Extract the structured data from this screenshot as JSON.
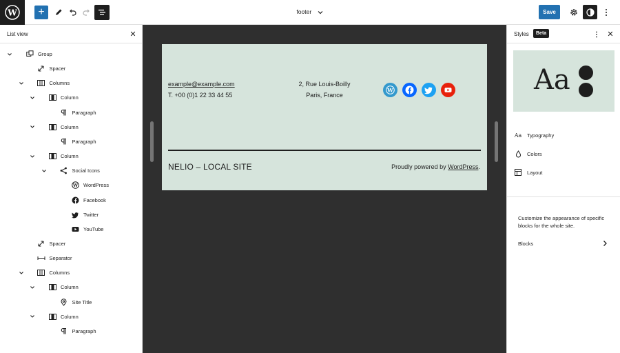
{
  "topbar": {
    "add_label": "+",
    "document_title": "footer",
    "save_label": "Save"
  },
  "list_view": {
    "title": "List view",
    "items": [
      {
        "label": "Group",
        "icon": "group-icon",
        "chevron": true
      },
      {
        "label": "Spacer",
        "icon": "spacer-icon",
        "chevron": false
      },
      {
        "label": "Columns",
        "icon": "columns-icon",
        "chevron": true
      },
      {
        "label": "Column",
        "icon": "column-icon",
        "chevron": true
      },
      {
        "label": "Paragraph",
        "icon": "paragraph-icon",
        "chevron": false
      },
      {
        "label": "Column",
        "icon": "column-icon",
        "chevron": true
      },
      {
        "label": "Paragraph",
        "icon": "paragraph-icon",
        "chevron": false
      },
      {
        "label": "Column",
        "icon": "column-icon",
        "chevron": true
      },
      {
        "label": "Social Icons",
        "icon": "share-icon",
        "chevron": true
      },
      {
        "label": "WordPress",
        "icon": "wordpress-icon",
        "chevron": false
      },
      {
        "label": "Facebook",
        "icon": "facebook-icon",
        "chevron": false
      },
      {
        "label": "Twitter",
        "icon": "twitter-icon",
        "chevron": false
      },
      {
        "label": "YouTube",
        "icon": "youtube-icon",
        "chevron": false
      },
      {
        "label": "Spacer",
        "icon": "spacer-icon",
        "chevron": false
      },
      {
        "label": "Separator",
        "icon": "separator-icon",
        "chevron": false
      },
      {
        "label": "Columns",
        "icon": "columns-icon",
        "chevron": true
      },
      {
        "label": "Column",
        "icon": "column-icon",
        "chevron": true
      },
      {
        "label": "Site Title",
        "icon": "map-marker-icon",
        "chevron": false
      },
      {
        "label": "Column",
        "icon": "column-icon",
        "chevron": true
      },
      {
        "label": "Paragraph",
        "icon": "paragraph-icon",
        "chevron": false
      }
    ]
  },
  "canvas": {
    "email": "example@example.com",
    "phone": "T. +00 (0)1 22 33 44 55",
    "address_line1": "2, Rue Louis-Boilly",
    "address_line2": "Paris, France",
    "social": [
      {
        "name": "WordPress",
        "color": "#3499cd"
      },
      {
        "name": "Facebook",
        "color": "#0866ff"
      },
      {
        "name": "Twitter",
        "color": "#1da1f2"
      },
      {
        "name": "YouTube",
        "color": "#ff0000"
      }
    ],
    "site_title": "NELIO – LOCAL SITE",
    "powered_prefix": "Proudly powered by ",
    "powered_link": "WordPress",
    "powered_suffix": ".",
    "background": "#d6e4dc"
  },
  "styles_panel": {
    "title": "Styles",
    "badge": "Beta",
    "preview_text": "Aa",
    "nav": [
      {
        "label": "Typography",
        "icon": "typography-icon"
      },
      {
        "label": "Colors",
        "icon": "droplet-icon"
      },
      {
        "label": "Layout",
        "icon": "layout-icon"
      }
    ],
    "description": "Customize the appearance of specific blocks for the whole site.",
    "blocks_label": "Blocks"
  },
  "colors": {
    "accent": "#2271b1",
    "dark": "#1e1e1e"
  }
}
